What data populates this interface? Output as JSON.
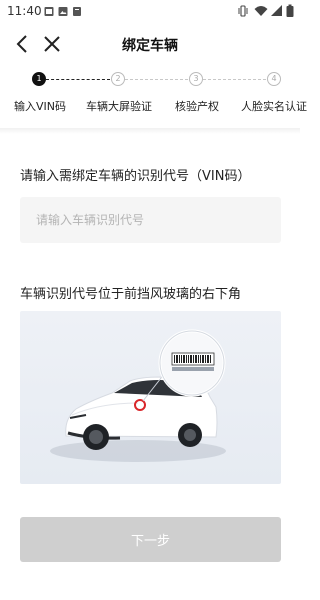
{
  "status_bar": {
    "time": "11:40",
    "left_icons": [
      "image-icon",
      "photo-icon",
      "app-icon"
    ],
    "right_icons": [
      "vibrate-icon",
      "wifi-icon",
      "signal-icon",
      "battery-icon"
    ]
  },
  "nav": {
    "title": "绑定车辆",
    "back_icon": "chevron-left-icon",
    "close_icon": "close-icon"
  },
  "stepper": {
    "steps": [
      {
        "number": "1",
        "label": "输入VIN码",
        "active": true
      },
      {
        "number": "2",
        "label": "车辆大屏验证",
        "active": false
      },
      {
        "number": "3",
        "label": "核验产权",
        "active": false
      },
      {
        "number": "4",
        "label": "人脸实名认证",
        "active": false
      }
    ]
  },
  "form": {
    "vin_prompt": "请输入需绑定车辆的识别代号（VIN码）",
    "vin_placeholder": "请输入车辆识别代号",
    "vin_value": ""
  },
  "hint": {
    "location_text": "车辆识别代号位于前挡风玻璃的右下角",
    "illustration_icon": "car-vin-location-illustration"
  },
  "actions": {
    "next_label": "下一步"
  },
  "colors": {
    "accent": "#111111",
    "disabled_button": "#cfcfcf",
    "marker": "#d9262a"
  }
}
